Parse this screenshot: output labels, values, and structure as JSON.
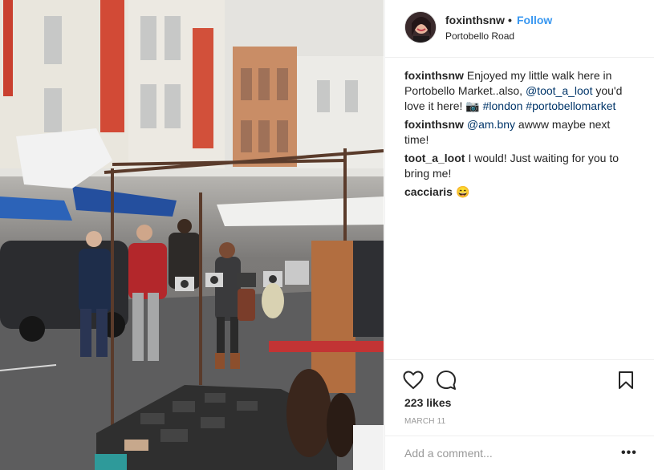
{
  "post": {
    "author": "foxinthsnw",
    "separator": "•",
    "follow_label": "Follow",
    "location": "Portobello Road"
  },
  "comments": [
    {
      "user": "foxinthsnw",
      "text_before": "Enjoyed my little walk here in Portobello Market..also, ",
      "mention": "@toot_a_loot",
      "text_middle": " you'd love it here! 📷 ",
      "tags": "#london #portobellomarket"
    },
    {
      "user": "foxinthsnw",
      "mention": "@am.bny",
      "text": " awww maybe next time!"
    },
    {
      "user": "toot_a_loot",
      "text": "I would! Just waiting for you to bring me!"
    },
    {
      "user": "cacciaris",
      "text": "😄"
    }
  ],
  "engagement": {
    "likes": "223 likes",
    "date": "MARCH 11"
  },
  "comment_box": {
    "placeholder": "Add a comment...",
    "more": "•••"
  },
  "icons": {
    "like": "heart-icon",
    "comment": "comment-bubble-icon",
    "save": "bookmark-icon",
    "more": "ellipsis-icon"
  },
  "colors": {
    "follow": "#3897f0",
    "link": "#003569",
    "muted": "#999999"
  }
}
